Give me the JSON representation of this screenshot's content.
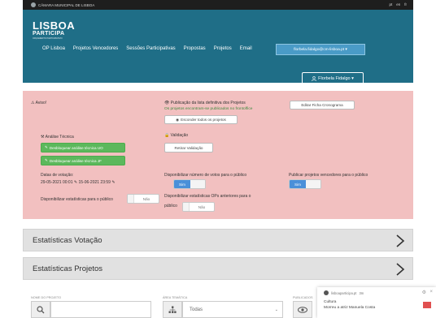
{
  "topbar": {
    "org": "CÂMARA MUNICIPAL DE LISBOA",
    "languages": [
      "pt",
      "en",
      "fr"
    ]
  },
  "logo": {
    "line1": "LISBOA",
    "line2": "PARTICIPA",
    "line3": "ORÇAMENTO PARTICIPATIVO"
  },
  "nav": {
    "items": [
      "OP Lisboa",
      "Projetos Vencedores",
      "Sessões Participativas",
      "Propostas",
      "Projetos",
      "Email"
    ],
    "email_button": "florbela.fidalgo@cm-lisboa.pt ▾",
    "user_button": "Florbela Fidalgo ▾"
  },
  "admin": {
    "aviso_label": "Aviso!",
    "publicacao_label": "Publicação da lista definitiva dos Projetos",
    "publicacao_status": "Os projetos encontram-se publicados no frontoffice",
    "editar_cronograma": "Editar Ficha Cronograma",
    "esconder_projetos": "Esconder todos os projetos",
    "analise_label": "Análise Técnica",
    "desbloquear_uo": "Desbloquear análise técnica UO",
    "desbloquear_jf": "Desbloquear análise técnica JF",
    "validacao_label": "Validação",
    "retirar_validacao": "Retirar Validação",
    "datas_label": "Datas de votação:",
    "datas_value": "29-05-2021 00:01",
    "datas_value2": "15-06-2021 23:59",
    "disp_votos_label": "Disponibilizar número de votos para o público",
    "disp_votos_toggle": "Sim",
    "publicar_vencedores_label": "Publicar projetos vencedores para o público",
    "publicar_vencedores_toggle": "Sim",
    "disp_estatisticas_label": "Disponibilizar estatísticas para o público",
    "disp_estatisticas_toggle": "Não",
    "disp_ops_label_1": "Disponibilizar estatísticas OPs anteriores para o",
    "disp_ops_label_2": "público",
    "disp_ops_toggle": "Não"
  },
  "panels": {
    "votacao": "Estatísticas Votação",
    "projetos": "Estatísticas Projetos"
  },
  "filters": {
    "nome_label": "NOME DO PROJETO",
    "area_label": "ÁREA TEMÁTICA",
    "area_value": "Todas",
    "publicados_label": "PUBLICADOS"
  },
  "notification": {
    "source": "lisboaparticipa.pt",
    "time": "3m",
    "line1": "Cultura",
    "line2": "Morreu a atriz Manuela Costa"
  },
  "colors": {
    "header": "#1f6e87",
    "admin_bg": "#f2c0c0",
    "green_btn": "#5cb85c",
    "toggle_on": "#4a90d9"
  }
}
